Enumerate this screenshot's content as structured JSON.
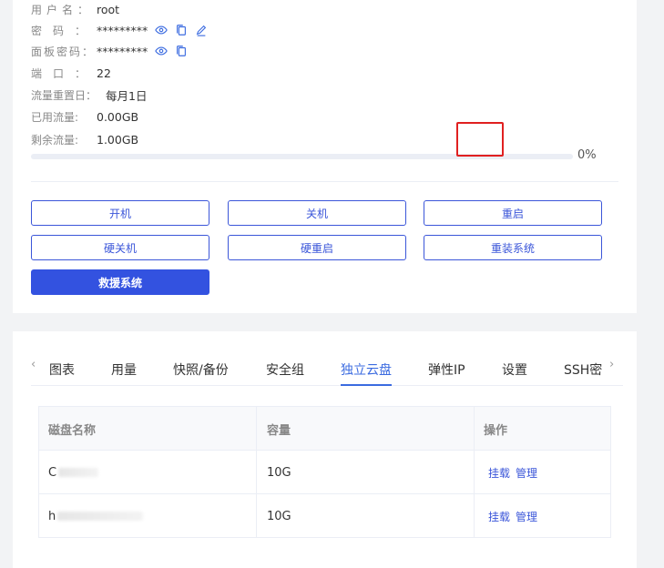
{
  "info": {
    "username_label": "用户名：",
    "username": "root",
    "password_label": "密码：",
    "password": "*********",
    "panel_password_label": "面板密码：",
    "panel_password": "*********",
    "port_label": "端口：",
    "port": "22",
    "reset_label": "流量重置日：",
    "reset": "每月1日",
    "used_label": "已用流量:",
    "used": "0.00GB",
    "remain_label": "剩余流量:",
    "remain": "1.00GB",
    "progress_value": 0,
    "progress_text": "0%"
  },
  "actions": {
    "power_on": "开机",
    "power_off": "关机",
    "restart": "重启",
    "hard_off": "硬关机",
    "hard_restart": "硬重启",
    "reinstall": "重装系统",
    "rescue": "救援系统"
  },
  "tabs": [
    "图表",
    "用量",
    "快照/备份",
    "安全组",
    "独立云盘",
    "弹性IP",
    "设置",
    "SSH密"
  ],
  "active_tab": "独立云盘",
  "table": {
    "headers": [
      "磁盘名称",
      "容量",
      "操作"
    ],
    "rows": [
      {
        "name": "C",
        "capacity": "10G",
        "mount": "挂载",
        "manage": "管理"
      },
      {
        "name": "h",
        "capacity": "10G",
        "mount": "挂载",
        "manage": "管理"
      }
    ]
  },
  "colors": {
    "accent": "#3b56d9",
    "primary_button": "#3352e0",
    "highlight": "#e02020"
  },
  "icons": {
    "view": "eye-icon",
    "copy": "copy-icon",
    "edit": "edit-icon",
    "prev": "chevron-left-icon",
    "next": "chevron-right-icon"
  }
}
